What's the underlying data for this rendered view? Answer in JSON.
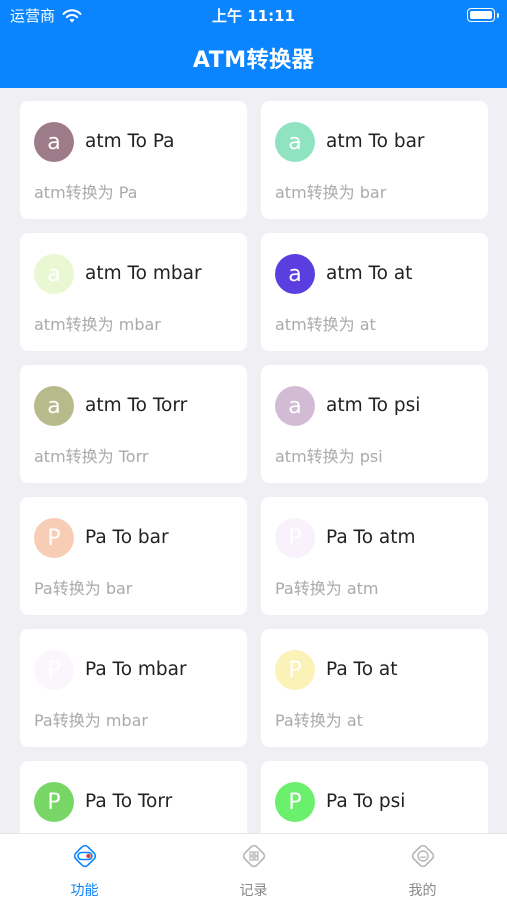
{
  "status": {
    "carrier": "运营商",
    "time": "上午 11:11"
  },
  "header": {
    "title": "ATM转换器"
  },
  "cards": [
    {
      "letter": "a",
      "title": "atm To Pa",
      "subtitle": "atm转换为 Pa",
      "color": "#9e7b89"
    },
    {
      "letter": "a",
      "title": "atm To bar",
      "subtitle": "atm转换为 bar",
      "color": "#8fe3c0"
    },
    {
      "letter": "a",
      "title": "atm To mbar",
      "subtitle": "atm转换为 mbar",
      "color": "#eaf7d3"
    },
    {
      "letter": "a",
      "title": "atm To at",
      "subtitle": "atm转换为 at",
      "color": "#5b3ee0"
    },
    {
      "letter": "a",
      "title": "atm To Torr",
      "subtitle": "atm转换为 Torr",
      "color": "#b7ba8b"
    },
    {
      "letter": "a",
      "title": "atm To psi",
      "subtitle": "atm转换为 psi",
      "color": "#d1bcd4"
    },
    {
      "letter": "P",
      "title": "Pa To bar",
      "subtitle": "Pa转换为 bar",
      "color": "#f7cdb6"
    },
    {
      "letter": "P",
      "title": "Pa To atm",
      "subtitle": "Pa转换为 atm",
      "color": "#f9f1fb"
    },
    {
      "letter": "P",
      "title": "Pa To mbar",
      "subtitle": "Pa转换为 mbar",
      "color": "#fbf6fb"
    },
    {
      "letter": "P",
      "title": "Pa To at",
      "subtitle": "Pa转换为 at",
      "color": "#fbf2b8"
    },
    {
      "letter": "P",
      "title": "Pa To Torr",
      "subtitle": "Pa转换为 Torr",
      "color": "#78d667"
    },
    {
      "letter": "P",
      "title": "Pa To psi",
      "subtitle": "Pa转换为 psi",
      "color": "#6bf06d"
    }
  ],
  "tabs": [
    {
      "label": "功能",
      "icon": "toggle-icon",
      "active": true
    },
    {
      "label": "记录",
      "icon": "grid-icon",
      "active": false
    },
    {
      "label": "我的",
      "icon": "profile-icon",
      "active": false
    }
  ],
  "colors": {
    "accent": "#0a84ff",
    "inactive": "#888888"
  }
}
